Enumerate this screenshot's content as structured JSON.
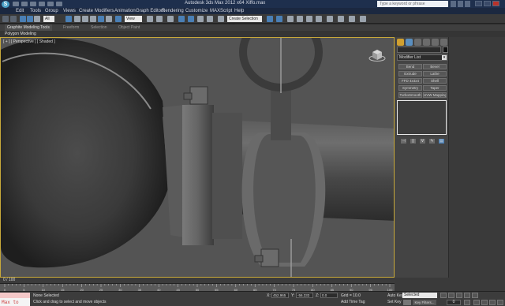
{
  "window": {
    "title": "Autodesk 3ds Max  2012 x64      Xiffo.max",
    "search_placeholder": "Type a keyword or phrase"
  },
  "menu": [
    "Edit",
    "Tools",
    "Group",
    "Views",
    "Create",
    "Modifiers",
    "Animation",
    "Graph Editors",
    "Rendering",
    "Customize",
    "MAXScript",
    "Help"
  ],
  "toolbar": {
    "filter_select": "All",
    "coord_select": "View",
    "named_selection_placeholder": "Create Selection Set"
  },
  "ribbon": {
    "tabs": [
      "Graphite Modeling Tools",
      "Freeform",
      "Selection",
      "Object Paint"
    ],
    "subpanel": "Polygon Modeling"
  },
  "viewport": {
    "label": "[ + ] [ Perspective ] [ Shaded ]"
  },
  "command_panel": {
    "modifier_list": "Modifier List",
    "buttons": [
      [
        "Bend",
        "Bevel"
      ],
      [
        "Extrude",
        "Lathe"
      ],
      [
        "FFD 4x4x4",
        "Shell"
      ],
      [
        "Symmetry",
        "Taper"
      ],
      [
        "TurboSmooth",
        "UVW Mapping Cl..."
      ]
    ],
    "stack_tools": [
      "⊣",
      "||",
      "∀",
      "✎",
      "▤"
    ]
  },
  "timeline": {
    "frame": "0 / 100",
    "ticks": [
      "0",
      "5",
      "10",
      "15",
      "20",
      "25",
      "30",
      "35",
      "40",
      "45",
      "50",
      "55",
      "60",
      "65",
      "70",
      "75",
      "80",
      "85",
      "90",
      "95",
      "100"
    ]
  },
  "status": {
    "maxscript": "Max to Physc",
    "selection": "None Selected",
    "prompt": "Click and drag to select and move objects",
    "x_label": "X:",
    "x_value": "452.965",
    "y_label": "Y:",
    "y_value": "-56.333",
    "z_label": "Z:",
    "z_value": "0.0",
    "grid": "Grid = 10.0",
    "time_tag": "Add Time Tag",
    "auto_key": "Auto Key",
    "set_key": "Set Key",
    "selection_set": "Selected",
    "key_filters": "Key Filters...",
    "frame_field": "0"
  }
}
